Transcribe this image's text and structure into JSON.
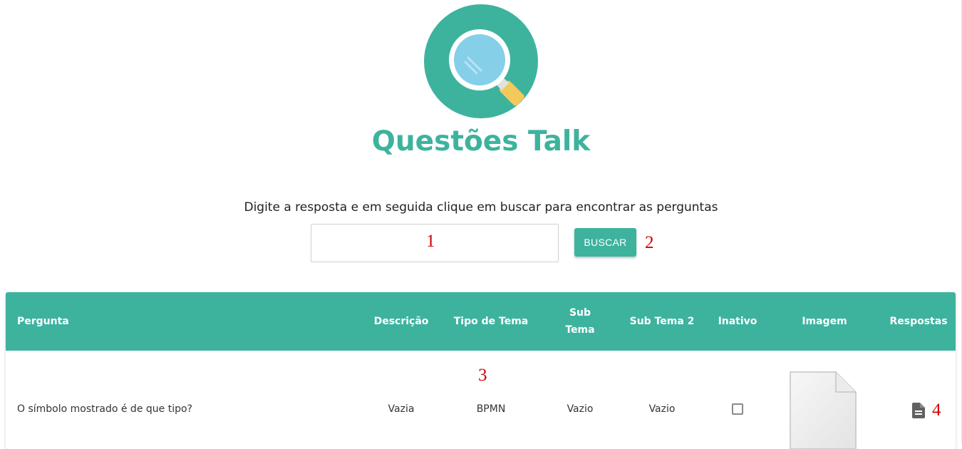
{
  "app": {
    "title": "Questões Talk",
    "logo_icon": "magnifier-icon",
    "accent_color": "#3db39e"
  },
  "search": {
    "instructions": "Digite a resposta e em seguida clique em buscar para encontrar as perguntas",
    "input_value": "",
    "button_label": "BUSCAR"
  },
  "annotations": {
    "a1": "1",
    "a2": "2",
    "a3": "3",
    "a4": "4"
  },
  "table": {
    "headers": {
      "pergunta": "Pergunta",
      "descricao": "Descrição",
      "tipo_tema": "Tipo de Tema",
      "sub_tema_line1": "Sub",
      "sub_tema_line2": "Tema",
      "sub_tema_2": "Sub Tema 2",
      "inativo": "Inativo",
      "imagem": "Imagem",
      "respostas": "Respostas"
    },
    "rows": [
      {
        "pergunta": "O símbolo mostrado é de que tipo?",
        "descricao": "Vazia",
        "tipo_tema": "BPMN",
        "sub_tema": "Vazio",
        "sub_tema_2": "Vazio",
        "inativo": false,
        "imagem_icon": "blank-image-icon",
        "respostas_icon": "document-icon"
      }
    ]
  }
}
